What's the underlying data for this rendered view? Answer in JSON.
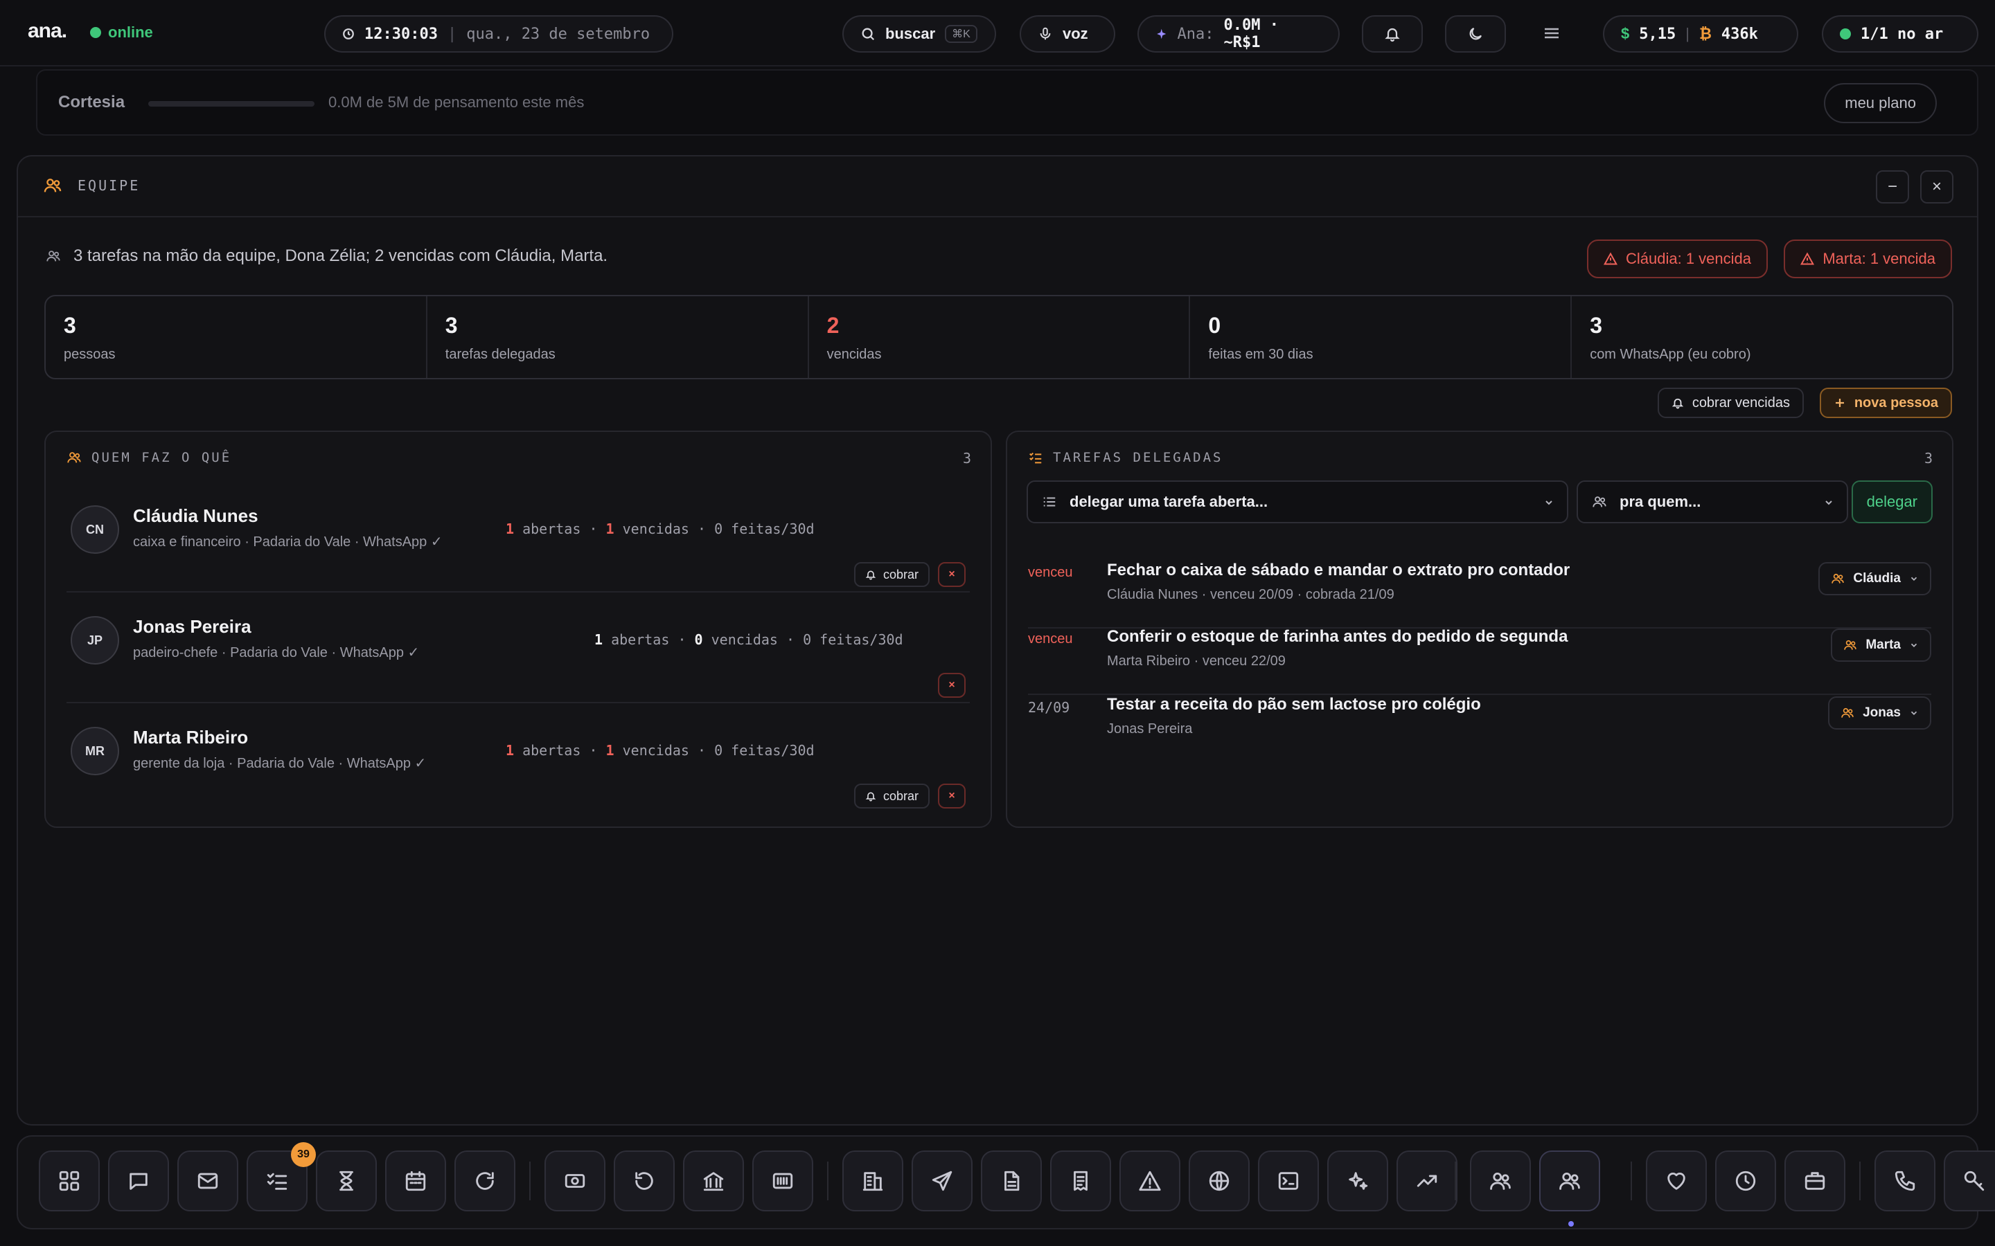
{
  "topbar": {
    "logo": "ana.",
    "status": "online",
    "time": "12:30:03",
    "date": "qua., 23 de setembro",
    "search_label": "buscar",
    "search_shortcut": "⌘K",
    "voice_label": "voz",
    "ana_label": "Ana:",
    "ana_value": "0.0M · ~R$1",
    "balance_usd": "5,15",
    "balance_btc": "436k",
    "live_label": "1/1 no ar"
  },
  "plan": {
    "title": "Cortesia",
    "usage_text": "0.0M de 5M de pensamento este mês",
    "usage_fraction": 0.0,
    "button": "meu plano"
  },
  "panel": {
    "title": "EQUIPE",
    "summary": "3 tarefas na mão da equipe, Dona Zélia; 2 vencidas com Cláudia, Marta.",
    "alerts": [
      "Cláudia: 1 vencida",
      "Marta: 1 vencida"
    ],
    "stats": [
      {
        "value": "3",
        "label": "pessoas"
      },
      {
        "value": "3",
        "label": "tarefas delegadas"
      },
      {
        "value": "2",
        "label": "vencidas"
      },
      {
        "value": "0",
        "label": "feitas em 30 dias"
      },
      {
        "value": "3",
        "label": "com WhatsApp (eu cobro)"
      }
    ],
    "btn_cobrar_vencidas": "cobrar vencidas",
    "btn_nova_pessoa": "nova pessoa"
  },
  "people_card": {
    "title": "QUEM FAZ O QUÊ",
    "count": "3",
    "people": [
      {
        "initials": "CN",
        "name": "Cláudia Nunes",
        "desc": "caixa e financeiro · Padaria do Vale · WhatsApp ✓",
        "abertas": "1",
        "vencidas": "1",
        "feitas": "0 feitas/30d",
        "cobrar": "cobrar"
      },
      {
        "initials": "JP",
        "name": "Jonas Pereira",
        "desc": "padeiro-chefe · Padaria do Vale · WhatsApp ✓",
        "abertas": "1",
        "vencidas": "0",
        "feitas": "0 feitas/30d",
        "cobrar": ""
      },
      {
        "initials": "MR",
        "name": "Marta Ribeiro",
        "desc": "gerente da loja · Padaria do Vale · WhatsApp ✓",
        "abertas": "1",
        "vencidas": "1",
        "feitas": "0 feitas/30d",
        "cobrar": "cobrar"
      }
    ],
    "abertas_word": "abertas",
    "vencidas_word": "vencidas",
    "dot": "·",
    "x_glyph": "×"
  },
  "tasks_card": {
    "title": "TAREFAS DELEGADAS",
    "count": "3",
    "task_select": "delegar uma tarefa aberta...",
    "person_select": "pra quem...",
    "delegate_btn": "delegar",
    "tasks": [
      {
        "status": "venceu",
        "title": "Fechar o caixa de sábado e mandar o extrato pro contador",
        "meta": "Cláudia Nunes · venceu 20/09 · cobrada 21/09",
        "assignee": "Cláudia"
      },
      {
        "status": "venceu",
        "title": "Conferir o estoque de farinha antes do pedido de segunda",
        "meta": "Marta Ribeiro · venceu 22/09",
        "assignee": "Marta"
      },
      {
        "status": "24/09",
        "title": "Testar a receita do pão sem lactose pro colégio",
        "meta": "Jonas Pereira",
        "assignee": "Jonas"
      }
    ]
  },
  "window": {
    "minimize": "−",
    "close": "×"
  },
  "dock": {
    "badge": "39",
    "icons": [
      "grid-icon",
      "chat-icon",
      "mail-icon",
      "tasks-icon",
      "hourglass-icon",
      "calendar-icon",
      "refresh-icon",
      "money-icon",
      "rotate-icon",
      "bank-icon",
      "barcode-icon",
      "building-icon",
      "send-icon",
      "document-icon",
      "receipt-icon",
      "warning-icon",
      "globe-icon",
      "terminal-icon",
      "sparkles-icon",
      "trending-icon",
      "team-icon",
      "team-active-icon",
      "heart-icon",
      "clock-icon",
      "briefcase-icon",
      "phone-icon",
      "key-icon"
    ]
  },
  "colors": {
    "accent_red": "#f0625a",
    "accent_green": "#3fc77a",
    "accent_orange": "#f29b3a",
    "accent_violet": "#7a7aff"
  }
}
